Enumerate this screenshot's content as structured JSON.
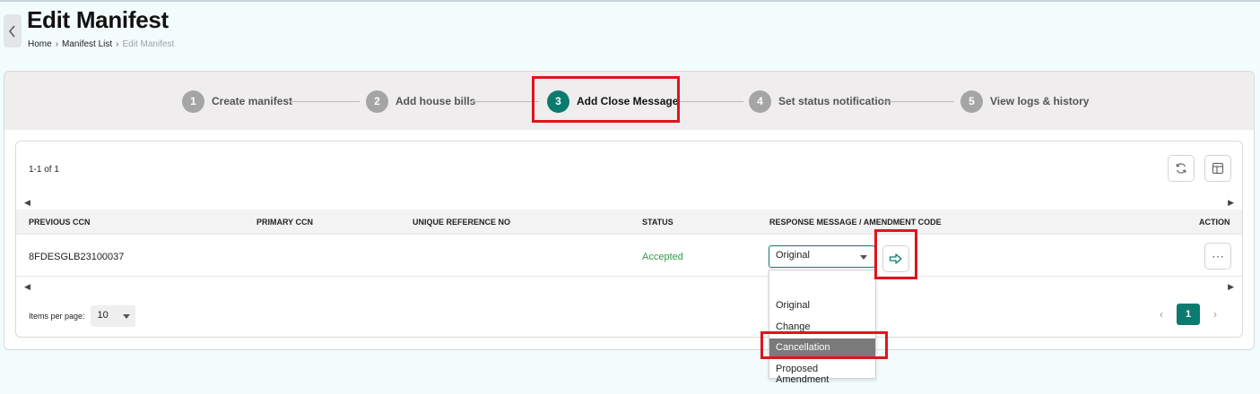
{
  "header": {
    "title": "Edit Manifest",
    "breadcrumb": [
      "Home",
      "Manifest List",
      "Edit Manifest"
    ],
    "back_icon": "chevron-left-icon"
  },
  "stepper": {
    "steps": [
      {
        "num": "1",
        "label": "Create manifest"
      },
      {
        "num": "2",
        "label": "Add house bills"
      },
      {
        "num": "3",
        "label": "Add Close Message",
        "active": true
      },
      {
        "num": "4",
        "label": "Set status notification"
      },
      {
        "num": "5",
        "label": "View logs & history"
      }
    ]
  },
  "table": {
    "count_text": "1-1 of 1",
    "columns": [
      "PREVIOUS CCN",
      "PRIMARY CCN",
      "UNIQUE REFERENCE NO",
      "STATUS",
      "RESPONSE MESSAGE / AMENDMENT CODE",
      "ACTION"
    ],
    "rows": [
      {
        "previous_ccn": "8FDESGLB23100037",
        "primary_ccn": "",
        "unique_ref": "",
        "status": "Accepted",
        "response": "Original"
      }
    ]
  },
  "dropdown": {
    "options": [
      "Original",
      "Change",
      "Cancellation",
      "Proposed Amendment"
    ],
    "highlighted": "Cancellation"
  },
  "pagination": {
    "items_per_page_label": "Items per page:",
    "items_per_page": "10",
    "current_page": "1"
  },
  "colors": {
    "accent": "#0c7b6f",
    "status_accepted": "#2e9e4a",
    "annotation": "#e0141e"
  }
}
